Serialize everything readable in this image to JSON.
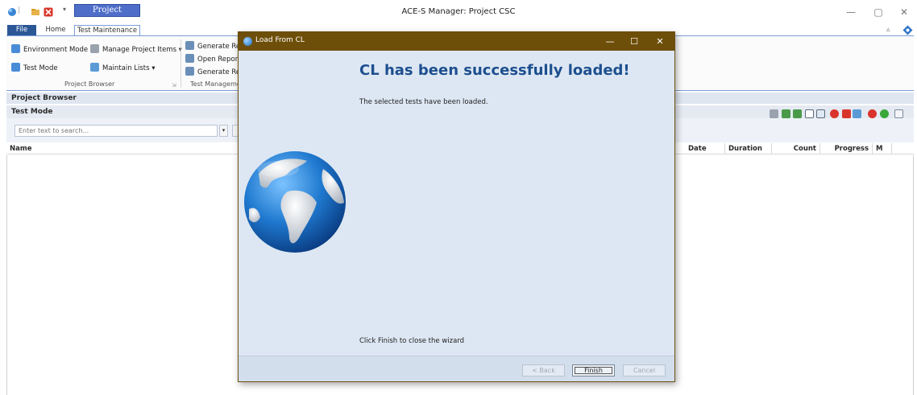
{
  "window": {
    "title": "ACE-S Manager: Project CSC",
    "context_tab": "Project",
    "controls": {
      "minimize": "—",
      "maximize": "▢",
      "close": "✕"
    }
  },
  "ribbon": {
    "tabs": [
      {
        "label": "File"
      },
      {
        "label": "Home"
      },
      {
        "label": "Test Maintenance"
      }
    ],
    "collapse_glyph": "▵",
    "groups": {
      "project_browser": {
        "label": "Project Browser",
        "items": [
          "Environment Mode",
          "Test Mode",
          "Manage Project Items ▾",
          "Maintain Lists ▾"
        ]
      },
      "test_management": {
        "label": "Test Manageme",
        "items": [
          "Generate Rep",
          "Open Report",
          "Generate Rep"
        ]
      }
    }
  },
  "panel": {
    "title": "Project Browser",
    "mode": "Test Mode",
    "search_placeholder": "Enter text to search...",
    "dropdown_glyph": "▾"
  },
  "grid": {
    "columns": [
      "Name",
      "Date",
      "Duration",
      "Count",
      "Progress",
      "M"
    ]
  },
  "dialog": {
    "title": "Load From CL",
    "heading": "CL has been successfully loaded!",
    "message": "The selected tests have been loaded.",
    "footer_message": "Click Finish to close the wizard",
    "buttons": {
      "back": "< Back",
      "finish": "Finish",
      "cancel": "Cancel"
    },
    "controls": {
      "minimize": "—",
      "maximize": "☐",
      "close": "✕"
    }
  },
  "colors": {
    "dialog_title_bar": "#6e4f09",
    "dialog_body": "#dde7f3",
    "heading": "#1d4f8f",
    "ribbon_accent": "#7a9ed8",
    "file_tab": "#2b5797",
    "context_tab": "#4e6ec9"
  },
  "icons": [
    "app-icon",
    "folder-icon",
    "close-red-icon",
    "environment-mode-icon",
    "test-mode-icon",
    "wrench-icon",
    "list-icon",
    "report-icon",
    "globe-icon",
    "help-icon"
  ]
}
